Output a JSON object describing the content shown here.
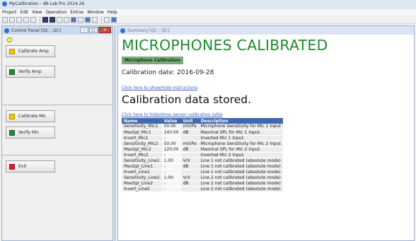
{
  "window": {
    "title": "MyCalibration - dB-Lab Pro 2014.26"
  },
  "menu": {
    "items": [
      "Project",
      "Edit",
      "View",
      "Operation",
      "Extras",
      "Window",
      "Help"
    ]
  },
  "control_panel": {
    "title": "Control Panel [QC - QC]",
    "buttons": {
      "calibrate_amp": "Calibrate Amp",
      "verify_amp": "Verify Amp",
      "calibrate_mic": "Calibrate Mic",
      "verify_mic": "Verify Mic",
      "exit": "Exit"
    },
    "colors": {
      "status": "#ffff66",
      "calibrate": "#f5c400",
      "verify": "#1f8a2e",
      "exit": "#d81b3b"
    }
  },
  "summary": {
    "title": "Summary [QC - QC]",
    "headline": "MICROPHONES CALIBRATED",
    "badge": "Microphone Calibration",
    "calibration_date": "Calibration date: 2016-09-28",
    "instructions_link": "Click here to show/hide Instructions",
    "stored_text": "Calibration data stored.",
    "sensor_table_link": "Click here to hide/show sensor calibration table",
    "table": {
      "headers": [
        "Name",
        "Value",
        "Unit",
        "Description"
      ],
      "rows": [
        [
          "Sensitivity_Mic1",
          "50.00",
          "mV/Pa",
          "Microphone Sensitivity for Mic 1 Input"
        ],
        [
          "MaxSpl_Mic1",
          "140.00",
          "dB",
          "Maximal SPL for Mic 1 Input."
        ],
        [
          "Invert_Mic1",
          "-",
          "",
          "Inverted Mic 1 Input."
        ],
        [
          "Sensitivity_Mic2",
          "50.00",
          "mV/Pa",
          "Microphone Sensitivity for Mic 2 Input"
        ],
        [
          "MaxSpl_Mic2",
          "120.00",
          "dB",
          "Maximal SPL for Mic 2 Input."
        ],
        [
          "Invert_Mic2",
          "-",
          "",
          "Inverted Mic 2 Input."
        ],
        [
          "Sensitivity_Line1",
          "1.00",
          "V/V",
          "Line 1 not calibrated (absolute mode)"
        ],
        [
          "MaxSpl_Line1",
          "-",
          "dB",
          "Line 1 not calibrated (absolute mode)"
        ],
        [
          "Invert_Line1",
          "-",
          "",
          "Line 1 not calibrated (absolute mode)"
        ],
        [
          "Sensitivity_Line2",
          "1.00",
          "V/V",
          "Line 2 not calibrated (absolute mode)"
        ],
        [
          "MaxSpl_Line2",
          "-",
          "dB",
          "Line 2 not calibrated (absolute mode)"
        ],
        [
          "Invert_Line2",
          "-",
          "",
          "Line 2 not calibrated (absolute mode)"
        ]
      ]
    }
  }
}
